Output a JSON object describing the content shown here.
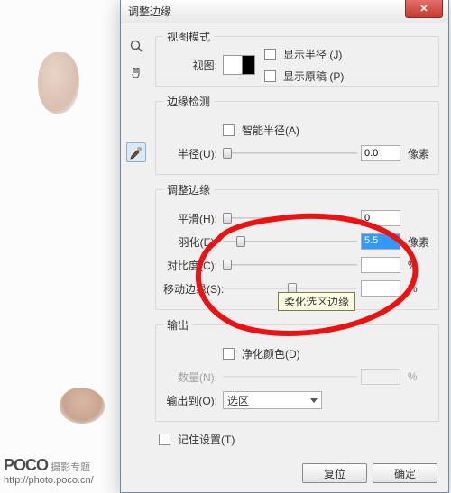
{
  "watermark": {
    "brand_strong": "POCO",
    "brand_rest": " 摄影专题",
    "url": "http://photo.poco.cn/"
  },
  "dialog": {
    "title": "调整边缘",
    "close": "X",
    "tooltip": "柔化选区边缘",
    "groups": {
      "viewmode": {
        "legend": "视图模式",
        "view_label": "视图:",
        "show_radius": "显示半径 (J)",
        "show_original": "显示原稿 (P)"
      },
      "edge": {
        "legend": "边缘检测",
        "smart_radius": "智能半径(A)",
        "radius_label": "半径(U):",
        "radius_value": "0.0",
        "unit_px": "像素"
      },
      "adjust": {
        "legend": "调整边缘",
        "smooth_label": "平滑(H):",
        "smooth_value": "0",
        "feather_label": "羽化(E):",
        "feather_value": "5.5",
        "feather_unit": "像素",
        "contrast_label": "对比度(C):",
        "contrast_value": "",
        "pct": "%",
        "shift_label": "移动边缘(S):",
        "shift_value": "",
        "shift_unit": "%"
      },
      "output": {
        "legend": "输出",
        "decon": "净化颜色(D)",
        "amount_label": "数量(N):",
        "amount_unit": "%",
        "outto_label": "输出到(O):",
        "outto_value": "选区"
      }
    },
    "remember": "记住设置(T)",
    "buttons": {
      "reset": "复位",
      "ok": "确定"
    }
  }
}
